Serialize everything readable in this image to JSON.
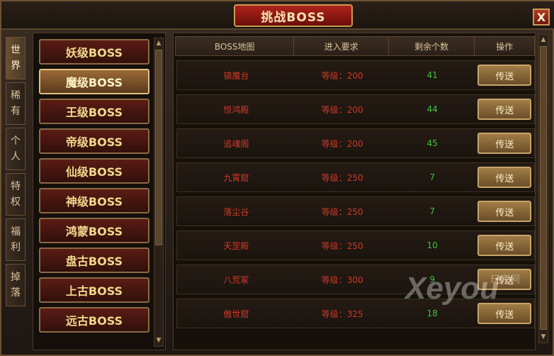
{
  "title": "挑战BOSS",
  "close_label": "X",
  "side_tabs": [
    {
      "label": "世界",
      "active": true
    },
    {
      "label": "稀有",
      "active": false
    },
    {
      "label": "个人",
      "active": false
    },
    {
      "label": "特权",
      "active": false
    },
    {
      "label": "福利",
      "active": false
    },
    {
      "label": "掉落",
      "active": false
    }
  ],
  "boss_categories": [
    {
      "label": "妖级BOSS",
      "active": false
    },
    {
      "label": "魔级BOSS",
      "active": true
    },
    {
      "label": "王级BOSS",
      "active": false
    },
    {
      "label": "帝级BOSS",
      "active": false
    },
    {
      "label": "仙级BOSS",
      "active": false
    },
    {
      "label": "神级BOSS",
      "active": false
    },
    {
      "label": "鸿蒙BOSS",
      "active": false
    },
    {
      "label": "盘古BOSS",
      "active": false
    },
    {
      "label": "上古BOSS",
      "active": false
    },
    {
      "label": "远古BOSS",
      "active": false
    }
  ],
  "table": {
    "headers": [
      "BOSS地图",
      "进入要求",
      "剩余个数",
      "操作"
    ],
    "rows": [
      {
        "map": "镇魔台",
        "req": "等级：200",
        "count": "41",
        "action": "传送"
      },
      {
        "map": "惊鸿殿",
        "req": "等级：200",
        "count": "44",
        "action": "传送"
      },
      {
        "map": "追魂阁",
        "req": "等级：200",
        "count": "45",
        "action": "传送"
      },
      {
        "map": "九霄窟",
        "req": "等级：250",
        "count": "7",
        "action": "传送"
      },
      {
        "map": "落尘谷",
        "req": "等级：250",
        "count": "7",
        "action": "传送"
      },
      {
        "map": "天罡殿",
        "req": "等级：250",
        "count": "10",
        "action": "传送"
      },
      {
        "map": "八荒冢",
        "req": "等级：300",
        "count": "9",
        "action": "传送"
      },
      {
        "map": "傲世窟",
        "req": "等级：325",
        "count": "18",
        "action": "传送"
      }
    ]
  },
  "watermark": {
    "text": "Xeyou",
    "sub": "玩家网"
  }
}
